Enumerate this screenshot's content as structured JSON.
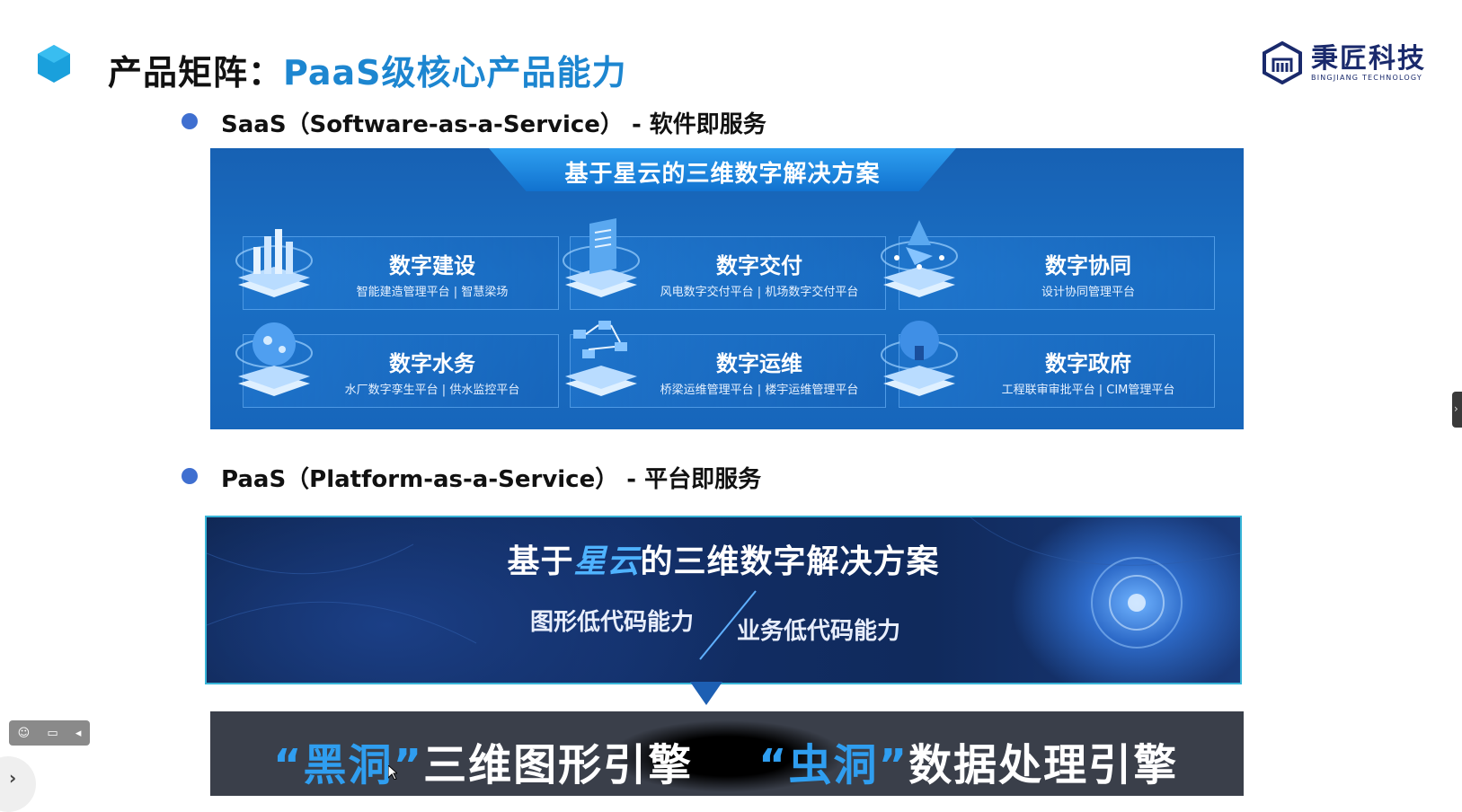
{
  "header": {
    "title_prefix": "产品矩阵：",
    "title_accent": "PaaS级核心产品能力",
    "logo_cn": "秉匠科技",
    "logo_en": "BINGJIANG TECHNOLOGY"
  },
  "saas": {
    "heading": "SaaS（Software-as-a-Service） - 软件即服务",
    "banner": "基于星云的三维数字解决方案",
    "cards": [
      {
        "title": "数字建设",
        "subtitle": "智能建造管理平台 | 智慧梁场",
        "icon": "bar-chart-cube-icon"
      },
      {
        "title": "数字交付",
        "subtitle": "风电数字交付平台 | 机场数字交付平台",
        "icon": "document-cube-icon"
      },
      {
        "title": "数字协同",
        "subtitle": "设计协同管理平台",
        "icon": "network-cube-icon"
      },
      {
        "title": "数字水务",
        "subtitle": "水厂数字孪生平台 | 供水监控平台",
        "icon": "globe-cube-icon"
      },
      {
        "title": "数字运维",
        "subtitle": "桥梁运维管理平台 | 楼宇运维管理平台",
        "icon": "nodes-cube-icon"
      },
      {
        "title": "数字政府",
        "subtitle": "工程联审审批平台 | CIM管理平台",
        "icon": "building-cube-icon"
      }
    ]
  },
  "paas": {
    "heading": "PaaS（Platform-as-a-Service） - 平台即服务",
    "banner_pre": "基于",
    "banner_hl": "星云",
    "banner_post": "的三维数字解决方案",
    "capability_1": "图形低代码能力",
    "capability_2": "业务低代码能力"
  },
  "engines": {
    "left_q_open": "“",
    "left_name": "黑洞",
    "left_q_close": "”",
    "left_suffix": "三维图形引擎",
    "right_q_open": "“",
    "right_name": "虫洞",
    "right_q_close": "”",
    "right_suffix": "数据处理引擎"
  },
  "colors": {
    "accent": "#1d86d0",
    "bullet": "#3f6fd0",
    "panel": "#1a6fc4"
  }
}
